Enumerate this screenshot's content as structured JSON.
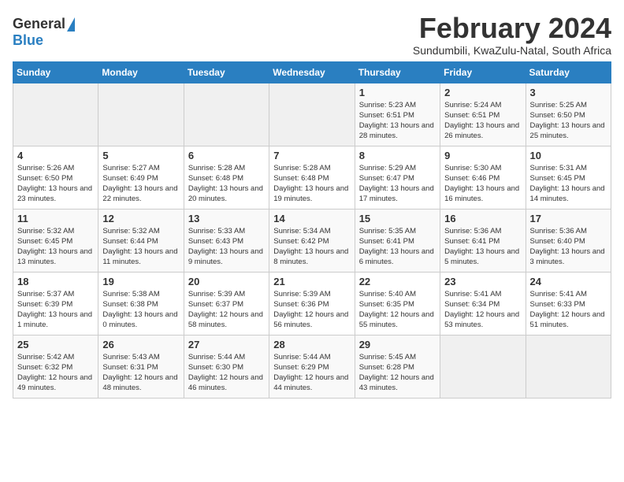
{
  "header": {
    "logo_general": "General",
    "logo_blue": "Blue",
    "month_title": "February 2024",
    "subtitle": "Sundumbili, KwaZulu-Natal, South Africa"
  },
  "days_of_week": [
    "Sunday",
    "Monday",
    "Tuesday",
    "Wednesday",
    "Thursday",
    "Friday",
    "Saturday"
  ],
  "weeks": [
    [
      {
        "day": "",
        "content": ""
      },
      {
        "day": "",
        "content": ""
      },
      {
        "day": "",
        "content": ""
      },
      {
        "day": "",
        "content": ""
      },
      {
        "day": "1",
        "content": "Sunrise: 5:23 AM\nSunset: 6:51 PM\nDaylight: 13 hours and 28 minutes."
      },
      {
        "day": "2",
        "content": "Sunrise: 5:24 AM\nSunset: 6:51 PM\nDaylight: 13 hours and 26 minutes."
      },
      {
        "day": "3",
        "content": "Sunrise: 5:25 AM\nSunset: 6:50 PM\nDaylight: 13 hours and 25 minutes."
      }
    ],
    [
      {
        "day": "4",
        "content": "Sunrise: 5:26 AM\nSunset: 6:50 PM\nDaylight: 13 hours and 23 minutes."
      },
      {
        "day": "5",
        "content": "Sunrise: 5:27 AM\nSunset: 6:49 PM\nDaylight: 13 hours and 22 minutes."
      },
      {
        "day": "6",
        "content": "Sunrise: 5:28 AM\nSunset: 6:48 PM\nDaylight: 13 hours and 20 minutes."
      },
      {
        "day": "7",
        "content": "Sunrise: 5:28 AM\nSunset: 6:48 PM\nDaylight: 13 hours and 19 minutes."
      },
      {
        "day": "8",
        "content": "Sunrise: 5:29 AM\nSunset: 6:47 PM\nDaylight: 13 hours and 17 minutes."
      },
      {
        "day": "9",
        "content": "Sunrise: 5:30 AM\nSunset: 6:46 PM\nDaylight: 13 hours and 16 minutes."
      },
      {
        "day": "10",
        "content": "Sunrise: 5:31 AM\nSunset: 6:45 PM\nDaylight: 13 hours and 14 minutes."
      }
    ],
    [
      {
        "day": "11",
        "content": "Sunrise: 5:32 AM\nSunset: 6:45 PM\nDaylight: 13 hours and 13 minutes."
      },
      {
        "day": "12",
        "content": "Sunrise: 5:32 AM\nSunset: 6:44 PM\nDaylight: 13 hours and 11 minutes."
      },
      {
        "day": "13",
        "content": "Sunrise: 5:33 AM\nSunset: 6:43 PM\nDaylight: 13 hours and 9 minutes."
      },
      {
        "day": "14",
        "content": "Sunrise: 5:34 AM\nSunset: 6:42 PM\nDaylight: 13 hours and 8 minutes."
      },
      {
        "day": "15",
        "content": "Sunrise: 5:35 AM\nSunset: 6:41 PM\nDaylight: 13 hours and 6 minutes."
      },
      {
        "day": "16",
        "content": "Sunrise: 5:36 AM\nSunset: 6:41 PM\nDaylight: 13 hours and 5 minutes."
      },
      {
        "day": "17",
        "content": "Sunrise: 5:36 AM\nSunset: 6:40 PM\nDaylight: 13 hours and 3 minutes."
      }
    ],
    [
      {
        "day": "18",
        "content": "Sunrise: 5:37 AM\nSunset: 6:39 PM\nDaylight: 13 hours and 1 minute."
      },
      {
        "day": "19",
        "content": "Sunrise: 5:38 AM\nSunset: 6:38 PM\nDaylight: 13 hours and 0 minutes."
      },
      {
        "day": "20",
        "content": "Sunrise: 5:39 AM\nSunset: 6:37 PM\nDaylight: 12 hours and 58 minutes."
      },
      {
        "day": "21",
        "content": "Sunrise: 5:39 AM\nSunset: 6:36 PM\nDaylight: 12 hours and 56 minutes."
      },
      {
        "day": "22",
        "content": "Sunrise: 5:40 AM\nSunset: 6:35 PM\nDaylight: 12 hours and 55 minutes."
      },
      {
        "day": "23",
        "content": "Sunrise: 5:41 AM\nSunset: 6:34 PM\nDaylight: 12 hours and 53 minutes."
      },
      {
        "day": "24",
        "content": "Sunrise: 5:41 AM\nSunset: 6:33 PM\nDaylight: 12 hours and 51 minutes."
      }
    ],
    [
      {
        "day": "25",
        "content": "Sunrise: 5:42 AM\nSunset: 6:32 PM\nDaylight: 12 hours and 49 minutes."
      },
      {
        "day": "26",
        "content": "Sunrise: 5:43 AM\nSunset: 6:31 PM\nDaylight: 12 hours and 48 minutes."
      },
      {
        "day": "27",
        "content": "Sunrise: 5:44 AM\nSunset: 6:30 PM\nDaylight: 12 hours and 46 minutes."
      },
      {
        "day": "28",
        "content": "Sunrise: 5:44 AM\nSunset: 6:29 PM\nDaylight: 12 hours and 44 minutes."
      },
      {
        "day": "29",
        "content": "Sunrise: 5:45 AM\nSunset: 6:28 PM\nDaylight: 12 hours and 43 minutes."
      },
      {
        "day": "",
        "content": ""
      },
      {
        "day": "",
        "content": ""
      }
    ]
  ]
}
